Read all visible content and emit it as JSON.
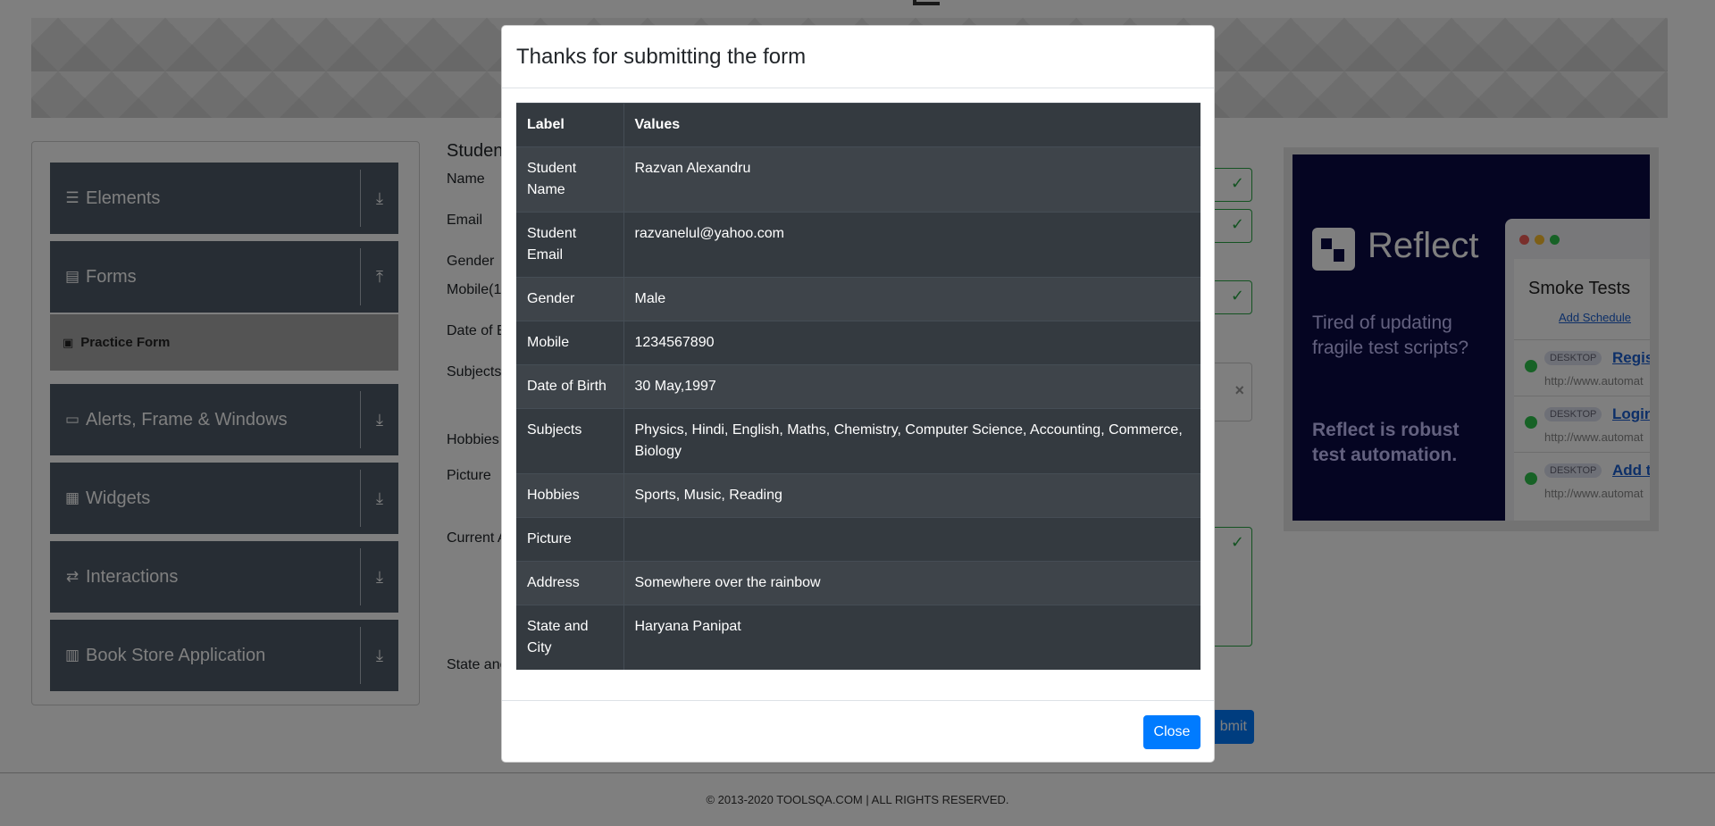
{
  "sidebar": {
    "groups": [
      {
        "label": "Elements",
        "icon": "hamburger-icon"
      },
      {
        "label": "Forms",
        "icon": "document-icon"
      },
      {
        "label": "Alerts, Frame & Windows",
        "icon": "window-icon"
      },
      {
        "label": "Widgets",
        "icon": "grid-icon"
      },
      {
        "label": "Interactions",
        "icon": "interaction-icon"
      },
      {
        "label": "Book Store Application",
        "icon": "books-icon"
      }
    ],
    "active_item": "Practice Form"
  },
  "form": {
    "title": "Studen",
    "labels": {
      "name": "Name",
      "email": "Email",
      "gender": "Gender",
      "mobile": "Mobile(1",
      "dob": "Date of E",
      "subjects": "Subjects",
      "hobbies": "Hobbies",
      "picture": "Picture",
      "address": "Current A",
      "state": "State anc"
    },
    "submit_label": "bmit"
  },
  "ad": {
    "brand": "Reflect",
    "tagline1": "Tired of updating fragile test scripts?",
    "tagline2": "Reflect is robust test automation.",
    "window_title": "Smoke Tests",
    "add_schedule": "Add Schedule",
    "rows": [
      {
        "tag": "DESKTOP",
        "link": "Registr",
        "url": "http://www.automat"
      },
      {
        "tag": "DESKTOP",
        "link": "Login",
        "url": "http://www.automat"
      },
      {
        "tag": "DESKTOP",
        "link": "Add to",
        "url": "http://www.automat"
      }
    ]
  },
  "footer": {
    "text": "© 2013-2020 TOOLSQA.COM | ALL RIGHTS RESERVED."
  },
  "modal": {
    "title": "Thanks for submitting the form",
    "headers": {
      "label": "Label",
      "values": "Values"
    },
    "rows": [
      {
        "label": "Student Name",
        "value": "Razvan Alexandru"
      },
      {
        "label": "Student Email",
        "value": "razvanelul@yahoo.com"
      },
      {
        "label": "Gender",
        "value": "Male"
      },
      {
        "label": "Mobile",
        "value": "1234567890"
      },
      {
        "label": "Date of Birth",
        "value": "30 May,1997"
      },
      {
        "label": "Subjects",
        "value": "Physics, Hindi, English, Maths, Chemistry, Computer Science, Accounting, Commerce, Biology"
      },
      {
        "label": "Hobbies",
        "value": "Sports, Music, Reading"
      },
      {
        "label": "Picture",
        "value": ""
      },
      {
        "label": "Address",
        "value": "Somewhere over the rainbow"
      },
      {
        "label": "State and City",
        "value": "Haryana Panipat"
      }
    ],
    "close_label": "Close"
  }
}
